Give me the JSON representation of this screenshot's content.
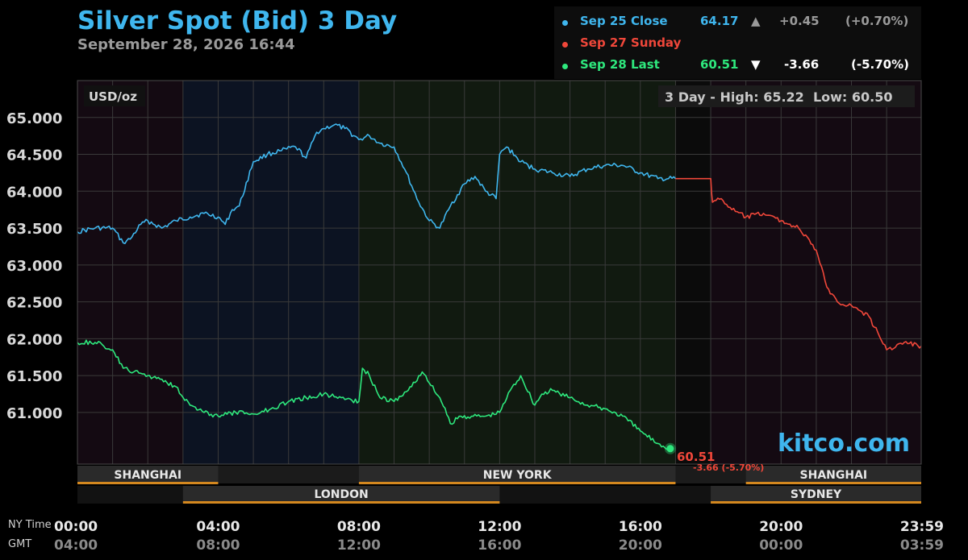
{
  "title": "Silver Spot (Bid) 3 Day",
  "subtitle": "September 28, 2026 16:44",
  "legend": {
    "rows": [
      {
        "label": "Sep 25 Close",
        "price": "64.17",
        "arrow": "▲",
        "change": "+0.45",
        "pct": "(+0.70%)",
        "color": "#3fb6ee"
      },
      {
        "label": "Sep 27 Sunday",
        "color": "#f0473a"
      },
      {
        "label": "Sep 28 Last",
        "price": "60.51",
        "arrow": "▼",
        "change": "-3.66",
        "pct": "(-5.70%)",
        "color": "#2ee87d"
      }
    ]
  },
  "panel": {
    "unit_label": "USD/oz",
    "range_text": "3 Day - High: 65.22  Low: 60.50",
    "watermark": "kitco.com",
    "last_marker": {
      "price": "60.51",
      "change": "-3.66 (-5.70%)"
    }
  },
  "row_labels": {
    "ny": "NY Time",
    "gmt": "GMT"
  },
  "colors": {
    "sep25": "#3fb6ee",
    "sep27": "#f0473a",
    "sep28": "#2ee87d",
    "session_bar": "#d4881f",
    "grid": "#3a3a3a"
  },
  "chart_data": {
    "type": "line",
    "title": "Silver Spot (Bid) 3 Day",
    "ylabel": "USD/oz",
    "ylim": [
      60.3,
      65.5
    ],
    "yticks": [
      65.0,
      64.5,
      64.0,
      63.5,
      63.0,
      62.5,
      62.0,
      61.5,
      61.0
    ],
    "ytick_labels": [
      "65.000",
      "64.500",
      "64.000",
      "63.500",
      "63.000",
      "62.500",
      "62.000",
      "61.500",
      "61.000"
    ],
    "xlim_hours": [
      0,
      23.983
    ],
    "xticks": [
      {
        "h": 0,
        "ny": "00:00",
        "gmt": "04:00"
      },
      {
        "h": 4,
        "ny": "04:00",
        "gmt": "08:00"
      },
      {
        "h": 8,
        "ny": "08:00",
        "gmt": "12:00"
      },
      {
        "h": 12,
        "ny": "12:00",
        "gmt": "16:00"
      },
      {
        "h": 16,
        "ny": "16:00",
        "gmt": "20:00"
      },
      {
        "h": 20,
        "ny": "20:00",
        "gmt": "00:00"
      },
      {
        "h": 23.983,
        "ny": "23:59",
        "gmt": "03:59"
      }
    ],
    "sessions": [
      {
        "name": "SHANGHAI",
        "start": 0,
        "end": 4,
        "row": 1
      },
      {
        "name": "NEW YORK",
        "start": 8,
        "end": 17,
        "row": 1
      },
      {
        "name": "SHANGHAI",
        "start": 19,
        "end": 24,
        "row": 1
      },
      {
        "name": "LONDON",
        "start": 3,
        "end": 12,
        "row": 2
      },
      {
        "name": "SYDNEY",
        "start": 18,
        "end": 24,
        "row": 2
      }
    ],
    "series": [
      {
        "name": "Sep 25 Close",
        "x": [
          0,
          0.5,
          1,
          1.3,
          1.5,
          1.8,
          2,
          2.4,
          2.8,
          3.2,
          3.6,
          4,
          4.2,
          4.4,
          4.6,
          5,
          5.4,
          5.8,
          6.2,
          6.5,
          6.8,
          7,
          7.3,
          7.6,
          8,
          8.3,
          8.6,
          9,
          9.3,
          9.7,
          10,
          10.3,
          10.6,
          11,
          11.3,
          11.6,
          11.9,
          12,
          12.2,
          12.6,
          13,
          13.5,
          14,
          14.5,
          15,
          15.5,
          16,
          16.5,
          17
        ],
        "y": [
          63.45,
          63.5,
          63.5,
          63.3,
          63.35,
          63.55,
          63.6,
          63.5,
          63.6,
          63.65,
          63.7,
          63.65,
          63.55,
          63.75,
          63.8,
          64.4,
          64.5,
          64.55,
          64.6,
          64.45,
          64.8,
          64.85,
          64.9,
          64.85,
          64.7,
          64.75,
          64.65,
          64.6,
          64.3,
          63.85,
          63.6,
          63.5,
          63.8,
          64.1,
          64.2,
          64.0,
          63.9,
          64.5,
          64.6,
          64.4,
          64.3,
          64.25,
          64.2,
          64.3,
          64.35,
          64.35,
          64.25,
          64.17,
          64.17
        ]
      },
      {
        "name": "Sep 27 Sunday",
        "x": [
          17,
          18,
          18.05,
          18.3,
          18.6,
          19,
          19.5,
          20,
          20.5,
          21,
          21.3,
          21.6,
          22,
          22.5,
          23,
          23.5,
          23.983
        ],
        "y": [
          64.17,
          64.17,
          63.85,
          63.9,
          63.75,
          63.65,
          63.7,
          63.6,
          63.5,
          63.2,
          62.7,
          62.5,
          62.45,
          62.3,
          61.85,
          61.95,
          61.9
        ]
      },
      {
        "name": "Sep 28 Last",
        "x": [
          0,
          0.5,
          1,
          1.3,
          1.6,
          2,
          2.4,
          2.8,
          3.2,
          3.6,
          4,
          4.5,
          5,
          5.5,
          6,
          6.5,
          7,
          7.5,
          8,
          8.1,
          8.3,
          8.6,
          9,
          9.4,
          9.8,
          10,
          10.3,
          10.6,
          10.9,
          11.2,
          11.6,
          12,
          12.3,
          12.6,
          13,
          13.2,
          13.5,
          14,
          14.5,
          15,
          15.5,
          16,
          16.5,
          16.85
        ],
        "y": [
          61.95,
          61.95,
          61.85,
          61.6,
          61.55,
          61.5,
          61.45,
          61.35,
          61.1,
          61.0,
          60.95,
          61.0,
          60.98,
          61.05,
          61.15,
          61.2,
          61.25,
          61.2,
          61.15,
          61.6,
          61.5,
          61.2,
          61.15,
          61.3,
          61.55,
          61.4,
          61.2,
          60.85,
          60.95,
          60.95,
          60.95,
          61.0,
          61.3,
          61.5,
          61.1,
          61.25,
          61.3,
          61.2,
          61.1,
          61.05,
          60.95,
          60.75,
          60.58,
          60.51
        ]
      }
    ]
  }
}
